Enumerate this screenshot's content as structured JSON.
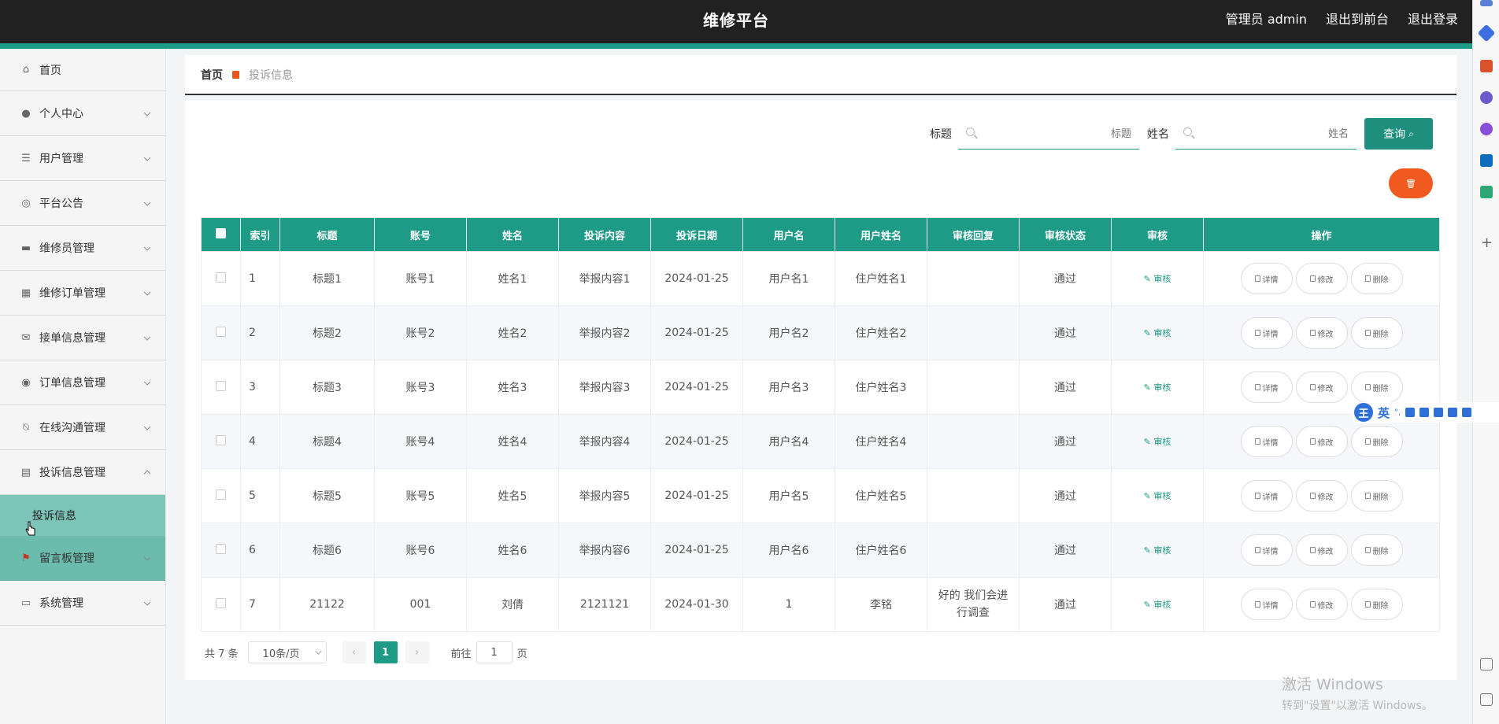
{
  "header": {
    "title": "维修平台",
    "admin": "管理员 admin",
    "to_front": "退出到前台",
    "logout": "退出登录"
  },
  "sidebar": {
    "items": [
      {
        "label": "首页",
        "icon": "home-icon"
      },
      {
        "label": "个人中心",
        "icon": "user-icon"
      },
      {
        "label": "用户管理",
        "icon": "list-icon"
      },
      {
        "label": "平台公告",
        "icon": "target-icon"
      },
      {
        "label": "维修员管理",
        "icon": "briefcase-icon"
      },
      {
        "label": "维修订单管理",
        "icon": "grid-icon"
      },
      {
        "label": "接单信息管理",
        "icon": "mail-icon"
      },
      {
        "label": "订单信息管理",
        "icon": "circle-icon"
      },
      {
        "label": "在线沟通管理",
        "icon": "bell-off-icon"
      },
      {
        "label": "投诉信息管理",
        "icon": "clipboard-icon"
      },
      {
        "label": "留言板管理",
        "icon": "flag-icon"
      },
      {
        "label": "系统管理",
        "icon": "chat-icon"
      }
    ],
    "submenu_active": "投诉信息"
  },
  "breadcrumb": {
    "home": "首页",
    "current": "投诉信息"
  },
  "search": {
    "title_label": "标题",
    "title_placeholder": "标题",
    "name_label": "姓名",
    "name_placeholder": "姓名",
    "query_button": "查询"
  },
  "table": {
    "headers": [
      "索引",
      "标题",
      "账号",
      "姓名",
      "投诉内容",
      "投诉日期",
      "用户名",
      "用户姓名",
      "审核回复",
      "审核状态",
      "审核",
      "操作"
    ],
    "rows": [
      {
        "index": "1",
        "title": "标题1",
        "account": "账号1",
        "name": "姓名1",
        "content": "举报内容1",
        "date": "2024-01-25",
        "username": "用户名1",
        "user_fullname": "住户姓名1",
        "reply": "",
        "status": "通过"
      },
      {
        "index": "2",
        "title": "标题2",
        "account": "账号2",
        "name": "姓名2",
        "content": "举报内容2",
        "date": "2024-01-25",
        "username": "用户名2",
        "user_fullname": "住户姓名2",
        "reply": "",
        "status": "通过"
      },
      {
        "index": "3",
        "title": "标题3",
        "account": "账号3",
        "name": "姓名3",
        "content": "举报内容3",
        "date": "2024-01-25",
        "username": "用户名3",
        "user_fullname": "住户姓名3",
        "reply": "",
        "status": "通过"
      },
      {
        "index": "4",
        "title": "标题4",
        "account": "账号4",
        "name": "姓名4",
        "content": "举报内容4",
        "date": "2024-01-25",
        "username": "用户名4",
        "user_fullname": "住户姓名4",
        "reply": "",
        "status": "通过"
      },
      {
        "index": "5",
        "title": "标题5",
        "account": "账号5",
        "name": "姓名5",
        "content": "举报内容5",
        "date": "2024-01-25",
        "username": "用户名5",
        "user_fullname": "住户姓名5",
        "reply": "",
        "status": "通过"
      },
      {
        "index": "6",
        "title": "标题6",
        "account": "账号6",
        "name": "姓名6",
        "content": "举报内容6",
        "date": "2024-01-25",
        "username": "用户名6",
        "user_fullname": "住户姓名6",
        "reply": "",
        "status": "通过"
      },
      {
        "index": "7",
        "title": "21122",
        "account": "001",
        "name": "刘倩",
        "content": "2121121",
        "date": "2024-01-30",
        "username": "1",
        "user_fullname": "李铭",
        "reply": "好的 我们会进行调查",
        "status": "通过"
      }
    ],
    "audit_label": "审核",
    "detail_label": "详情",
    "edit_label": "修改",
    "delete_label": "删除"
  },
  "pagination": {
    "total": "共 7 条",
    "page_size": "10条/页",
    "current_page": "1",
    "goto_prefix": "前往",
    "goto_value": "1",
    "goto_suffix": "页"
  },
  "ime": {
    "logo": "王",
    "mode": "英"
  },
  "watermark": {
    "line1": "激活 Windows",
    "line2": "转到\"设置\"以激活 Windows。"
  },
  "colors": {
    "accent": "#1d9b86",
    "topbar": "#212121",
    "delete": "#f05a1e"
  }
}
